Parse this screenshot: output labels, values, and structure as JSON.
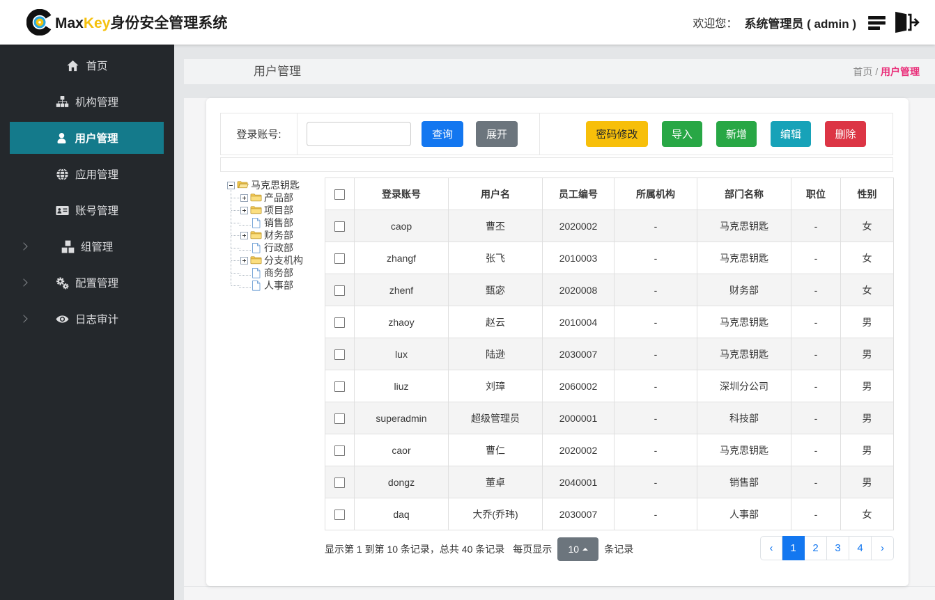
{
  "topbar": {
    "brand_max": "Max",
    "brand_key": "Key",
    "brand_suffix": "身份安全管理系统",
    "welcome_label": "欢迎您：",
    "user": "系统管理员 ( admin )"
  },
  "sidebar": {
    "items": [
      {
        "label": "首页",
        "icon": "home-icon",
        "active": false,
        "chevron": false
      },
      {
        "label": "机构管理",
        "icon": "sitemap-icon",
        "active": false,
        "chevron": false
      },
      {
        "label": "用户管理",
        "icon": "user-icon",
        "active": true,
        "chevron": false
      },
      {
        "label": "应用管理",
        "icon": "globe-icon",
        "active": false,
        "chevron": false
      },
      {
        "label": "账号管理",
        "icon": "idcard-icon",
        "active": false,
        "chevron": false
      },
      {
        "label": "组管理",
        "icon": "cubes-icon",
        "active": false,
        "chevron": true
      },
      {
        "label": "配置管理",
        "icon": "cogs-icon",
        "active": false,
        "chevron": true
      },
      {
        "label": "日志审计",
        "icon": "eye-icon",
        "active": false,
        "chevron": true
      }
    ]
  },
  "page": {
    "title": "用户管理",
    "breadcrumb_home": "首页",
    "breadcrumb_sep": "/",
    "breadcrumb_current": "用户管理"
  },
  "toolbar": {
    "search_label": "登录账号:",
    "search_value": "",
    "query": "查询",
    "expand": "展开",
    "password": "密码修改",
    "import": "导入",
    "add": "新增",
    "edit": "编辑",
    "delete": "删除"
  },
  "tree": {
    "root": {
      "label": "马克思钥匙",
      "icon": "folder-open-icon",
      "expander": "minus"
    },
    "children": [
      {
        "label": "产品部",
        "icon": "folder-icon",
        "expander": "plus"
      },
      {
        "label": "项目部",
        "icon": "folder-icon",
        "expander": "plus"
      },
      {
        "label": "销售部",
        "icon": "file-icon",
        "expander": "none"
      },
      {
        "label": "财务部",
        "icon": "folder-icon",
        "expander": "plus"
      },
      {
        "label": "行政部",
        "icon": "file-icon",
        "expander": "none"
      },
      {
        "label": "分支机构",
        "icon": "folder-icon",
        "expander": "plus"
      },
      {
        "label": "商务部",
        "icon": "file-icon",
        "expander": "none"
      },
      {
        "label": "人事部",
        "icon": "file-icon",
        "expander": "none"
      }
    ]
  },
  "table": {
    "columns": [
      "登录账号",
      "用户名",
      "员工编号",
      "所属机构",
      "部门名称",
      "职位",
      "性别"
    ],
    "rows": [
      {
        "cells": [
          "caop",
          "曹丕",
          "2020002",
          "-",
          "马克思钥匙",
          "-",
          "女"
        ]
      },
      {
        "cells": [
          "zhangf",
          "张飞",
          "2010003",
          "-",
          "马克思钥匙",
          "-",
          "女"
        ]
      },
      {
        "cells": [
          "zhenf",
          "甄宓",
          "2020008",
          "-",
          "财务部",
          "-",
          "女"
        ]
      },
      {
        "cells": [
          "zhaoy",
          "赵云",
          "2010004",
          "-",
          "马克思钥匙",
          "-",
          "男"
        ]
      },
      {
        "cells": [
          "lux",
          "陆逊",
          "2030007",
          "-",
          "马克思钥匙",
          "-",
          "男"
        ]
      },
      {
        "cells": [
          "liuz",
          "刘璋",
          "2060002",
          "-",
          "深圳分公司",
          "-",
          "男"
        ]
      },
      {
        "cells": [
          "superadmin",
          "超级管理员",
          "2000001",
          "-",
          "科技部",
          "-",
          "男"
        ]
      },
      {
        "cells": [
          "caor",
          "曹仁",
          "2020002",
          "-",
          "马克思钥匙",
          "-",
          "男"
        ]
      },
      {
        "cells": [
          "dongz",
          "董卓",
          "2040001",
          "-",
          "销售部",
          "-",
          "男"
        ]
      },
      {
        "cells": [
          "daq",
          "大乔(乔玮)",
          "2030007",
          "-",
          "人事部",
          "-",
          "女"
        ]
      }
    ]
  },
  "pagination": {
    "summary": "显示第 1 到第 10 条记录，总共 40 条记录",
    "per_page_label": "每页显示",
    "page_size": "10",
    "suffix": "条记录",
    "pages": [
      {
        "label": "‹",
        "active": false
      },
      {
        "label": "1",
        "active": true
      },
      {
        "label": "2",
        "active": false
      },
      {
        "label": "3",
        "active": false
      },
      {
        "label": "4",
        "active": false
      },
      {
        "label": "›",
        "active": false
      }
    ]
  },
  "colors": {
    "sidebar_active_teal": "#147a8b",
    "primary_blue": "#1377f0",
    "secondary_gray": "#6c757d",
    "warning_yellow": "#f7bf0a",
    "success_green": "#28a745",
    "info_teal": "#17a2b8",
    "danger_red": "#dc3545",
    "breadcrumb_pink": "#e9307a",
    "brand_yellow": "#f5c10e"
  }
}
